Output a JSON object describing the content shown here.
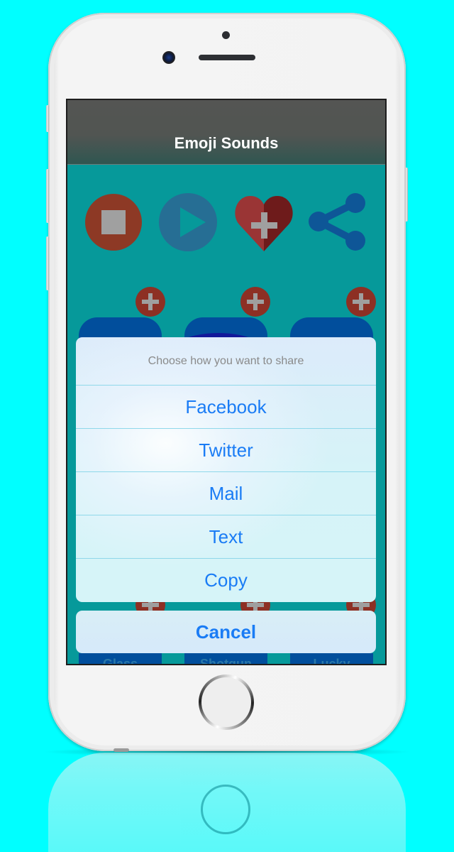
{
  "app": {
    "title": "Emoji Sounds"
  },
  "controls": [
    {
      "name": "stop",
      "icon": "stop-icon",
      "color": "#8d3925"
    },
    {
      "name": "play",
      "icon": "play-icon",
      "color": "#266e94"
    },
    {
      "name": "favorite",
      "icon": "heart-plus-icon",
      "color": "#9a3535"
    },
    {
      "name": "share",
      "icon": "share-icon",
      "color": "#0e5697"
    }
  ],
  "sounds": [
    {
      "label": "Glass"
    },
    {
      "label": "Shotgun"
    },
    {
      "label": "Lucky"
    }
  ],
  "action_sheet": {
    "title": "Choose how you want to share",
    "options": [
      {
        "label": "Facebook"
      },
      {
        "label": "Twitter"
      },
      {
        "label": "Mail"
      },
      {
        "label": "Text"
      },
      {
        "label": "Copy"
      }
    ],
    "cancel_label": "Cancel"
  },
  "colors": {
    "background": "#00ffff",
    "screen": "#06999a",
    "accent": "#1a7cf5",
    "tile": "#014e9c",
    "badge": "#8d3024"
  }
}
